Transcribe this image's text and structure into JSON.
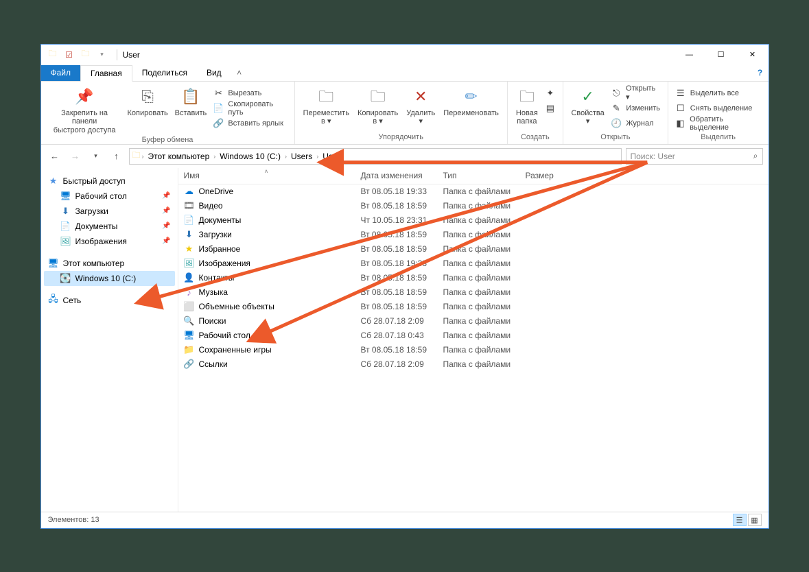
{
  "window": {
    "title": "User"
  },
  "tabs": {
    "file": "Файл",
    "home": "Главная",
    "share": "Поделиться",
    "view": "Вид"
  },
  "ribbon": {
    "pin": "Закрепить на панели\nбыстрого доступа",
    "copy": "Копировать",
    "paste": "Вставить",
    "cut": "Вырезать",
    "copypath": "Скопировать путь",
    "pastelnk": "Вставить ярлык",
    "group_clipboard": "Буфер обмена",
    "moveto": "Переместить\nв ▾",
    "copyto": "Копировать\nв ▾",
    "delete": "Удалить\n▾",
    "rename": "Переименовать",
    "group_organize": "Упорядочить",
    "newfolder": "Новая\nпапка",
    "group_create": "Создать",
    "properties": "Свойства\n▾",
    "open": "Открыть ▾",
    "edit": "Изменить",
    "history": "Журнал",
    "group_open": "Открыть",
    "selectall": "Выделить все",
    "selectnone": "Снять выделение",
    "invert": "Обратить выделение",
    "group_select": "Выделить"
  },
  "breadcrumb": [
    "Этот компьютер",
    "Windows 10 (C:)",
    "Users",
    "User"
  ],
  "search": {
    "placeholder": "Поиск: User"
  },
  "tree": {
    "quick": "Быстрый доступ",
    "desktop": "Рабочий стол",
    "downloads": "Загрузки",
    "documents": "Документы",
    "pictures": "Изображения",
    "thispc": "Этот компьютер",
    "drivec": "Windows 10 (C:)",
    "network": "Сеть"
  },
  "columns": {
    "name": "Имя",
    "date": "Дата изменения",
    "type": "Тип",
    "size": "Размер"
  },
  "items": [
    {
      "icon": "☁",
      "iconColor": "#0078d4",
      "name": "OneDrive",
      "date": "Вт 08.05.18 19:33",
      "type": "Папка с файлами"
    },
    {
      "icon": "🎞",
      "iconColor": "#555",
      "name": "Видео",
      "date": "Вт 08.05.18 18:59",
      "type": "Папка с файлами"
    },
    {
      "icon": "📄",
      "iconColor": "#5b9bd5",
      "name": "Документы",
      "date": "Чт 10.05.18 23:31",
      "type": "Папка с файлами"
    },
    {
      "icon": "⬇",
      "iconColor": "#2e75b6",
      "name": "Загрузки",
      "date": "Вт 08.05.18 18:59",
      "type": "Папка с файлами"
    },
    {
      "icon": "★",
      "iconColor": "#f0c808",
      "name": "Избранное",
      "date": "Вт 08.05.18 18:59",
      "type": "Папка с файлами"
    },
    {
      "icon": "🖼",
      "iconColor": "#3da9a9",
      "name": "Изображения",
      "date": "Вт 08.05.18 19:33",
      "type": "Папка с файлами"
    },
    {
      "icon": "👤",
      "iconColor": "#5b9bd5",
      "name": "Контакты",
      "date": "Вт 08.05.18 18:59",
      "type": "Папка с файлами"
    },
    {
      "icon": "♪",
      "iconColor": "#a46cc9",
      "name": "Музыка",
      "date": "Вт 08.05.18 18:59",
      "type": "Папка с файлами"
    },
    {
      "icon": "⬜",
      "iconColor": "#3dc1c1",
      "name": "Объемные объекты",
      "date": "Вт 08.05.18 18:59",
      "type": "Папка с файлами"
    },
    {
      "icon": "🔍",
      "iconColor": "#5b9bd5",
      "name": "Поиски",
      "date": "Сб 28.07.18 2:09",
      "type": "Папка с файлами"
    },
    {
      "icon": "🖥",
      "iconColor": "#0078d4",
      "name": "Рабочий стол",
      "date": "Сб 28.07.18 0:43",
      "type": "Папка с файлами"
    },
    {
      "icon": "📁",
      "iconColor": "#f8d373",
      "name": "Сохраненные игры",
      "date": "Вт 08.05.18 18:59",
      "type": "Папка с файлами"
    },
    {
      "icon": "🔗",
      "iconColor": "#4a90e2",
      "name": "Ссылки",
      "date": "Сб 28.07.18 2:09",
      "type": "Папка с файлами"
    }
  ],
  "status": "Элементов: 13"
}
